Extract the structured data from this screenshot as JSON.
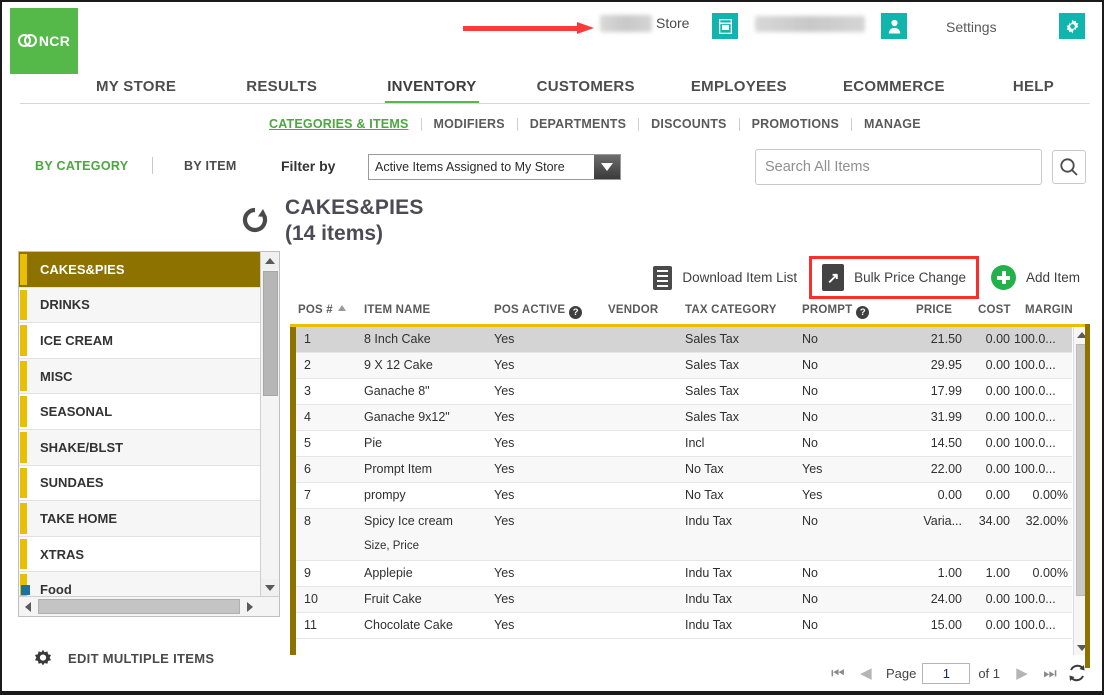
{
  "header": {
    "logo_text": "NCR",
    "store_label": "Store",
    "store_name_redacted": "",
    "user_name_redacted": "",
    "settings_label": "Settings",
    "icons": [
      "store-switch-icon",
      "user-account-icon",
      "gear-icon"
    ],
    "annotation": "red-arrow-pointing-to-store-name"
  },
  "mainnav": {
    "items": [
      {
        "label": "MY STORE",
        "active": false
      },
      {
        "label": "RESULTS",
        "active": false
      },
      {
        "label": "INVENTORY",
        "active": true
      },
      {
        "label": "CUSTOMERS",
        "active": false
      },
      {
        "label": "EMPLOYEES",
        "active": false
      },
      {
        "label": "ECOMMERCE",
        "active": false
      },
      {
        "label": "HELP",
        "active": false
      }
    ]
  },
  "subnav": {
    "items": [
      {
        "label": "CATEGORIES & ITEMS",
        "active": true
      },
      {
        "label": "MODIFIERS",
        "active": false
      },
      {
        "label": "DEPARTMENTS",
        "active": false
      },
      {
        "label": "DISCOUNTS",
        "active": false
      },
      {
        "label": "PROMOTIONS",
        "active": false
      },
      {
        "label": "MANAGE",
        "active": false
      }
    ]
  },
  "filterbar": {
    "by_category": "BY CATEGORY",
    "by_item": "BY ITEM",
    "filter_by_label": "Filter by",
    "filter_selected": "Active Items Assigned to My Store",
    "search_placeholder": "Search All Items"
  },
  "category_header": {
    "title": "CAKES&PIES",
    "count": "(14 items)"
  },
  "sidebar": {
    "categories": [
      {
        "label": "CAKES&PIES",
        "selected": true
      },
      {
        "label": "DRINKS",
        "selected": false
      },
      {
        "label": "ICE CREAM",
        "selected": false
      },
      {
        "label": "MISC",
        "selected": false
      },
      {
        "label": "SEASONAL",
        "selected": false
      },
      {
        "label": "SHAKE/BLST",
        "selected": false
      },
      {
        "label": "SUNDAES",
        "selected": false
      },
      {
        "label": "TAKE HOME",
        "selected": false
      },
      {
        "label": "XTRAS",
        "selected": false
      },
      {
        "label": "Food",
        "selected": false
      }
    ],
    "edit_multiple_label": "EDIT MULTIPLE ITEMS"
  },
  "actions": {
    "download": "Download Item List",
    "bulk_price_change": "Bulk Price Change",
    "add_item": "Add Item",
    "highlight_color": "#fb2e2e"
  },
  "table": {
    "columns": [
      "POS #",
      "ITEM NAME",
      "POS ACTIVE",
      "VENDOR",
      "TAX CATEGORY",
      "PROMPT",
      "PRICE",
      "COST",
      "MARGIN"
    ],
    "sorted_column": "POS #",
    "sort_direction": "asc",
    "rows": [
      {
        "pos": "1",
        "name": "8 Inch Cake",
        "sub": "",
        "active": "Yes",
        "vendor": "",
        "tax": "Sales Tax",
        "prompt": "No",
        "price": "21.50",
        "cost": "0.00",
        "margin": "100.0..."
      },
      {
        "pos": "2",
        "name": "9 X 12 Cake",
        "sub": "",
        "active": "Yes",
        "vendor": "",
        "tax": "Sales Tax",
        "prompt": "No",
        "price": "29.95",
        "cost": "0.00",
        "margin": "100.0..."
      },
      {
        "pos": "3",
        "name": "Ganache 8\"",
        "sub": "",
        "active": "Yes",
        "vendor": "",
        "tax": "Sales Tax",
        "prompt": "No",
        "price": "17.99",
        "cost": "0.00",
        "margin": "100.0..."
      },
      {
        "pos": "4",
        "name": "Ganache 9x12\"",
        "sub": "",
        "active": "Yes",
        "vendor": "",
        "tax": "Sales Tax",
        "prompt": "No",
        "price": "31.99",
        "cost": "0.00",
        "margin": "100.0..."
      },
      {
        "pos": "5",
        "name": "Pie",
        "sub": "",
        "active": "Yes",
        "vendor": "",
        "tax": "Incl",
        "prompt": "No",
        "price": "14.50",
        "cost": "0.00",
        "margin": "100.0..."
      },
      {
        "pos": "6",
        "name": "Prompt Item",
        "sub": "",
        "active": "Yes",
        "vendor": "",
        "tax": "No Tax",
        "prompt": "Yes",
        "price": "22.00",
        "cost": "0.00",
        "margin": "100.0..."
      },
      {
        "pos": "7",
        "name": "prompy",
        "sub": "",
        "active": "Yes",
        "vendor": "",
        "tax": "No Tax",
        "prompt": "Yes",
        "price": "0.00",
        "cost": "0.00",
        "margin": "0.00%"
      },
      {
        "pos": "8",
        "name": "Spicy Ice cream",
        "sub": "Size, Price",
        "active": "Yes",
        "vendor": "",
        "tax": "Indu Tax",
        "prompt": "No",
        "price": "Varia...",
        "cost": "34.00",
        "margin": "32.00%"
      },
      {
        "pos": "9",
        "name": "Applepie",
        "sub": "",
        "active": "Yes",
        "vendor": "",
        "tax": "Indu Tax",
        "prompt": "No",
        "price": "1.00",
        "cost": "1.00",
        "margin": "0.00%"
      },
      {
        "pos": "10",
        "name": "Fruit Cake",
        "sub": "",
        "active": "Yes",
        "vendor": "",
        "tax": "Indu Tax",
        "prompt": "No",
        "price": "24.00",
        "cost": "0.00",
        "margin": "100.0..."
      },
      {
        "pos": "11",
        "name": "Chocolate Cake",
        "sub": "",
        "active": "Yes",
        "vendor": "",
        "tax": "Indu Tax",
        "prompt": "No",
        "price": "15.00",
        "cost": "0.00",
        "margin": "100.0..."
      }
    ]
  },
  "pagination": {
    "page_label": "Page",
    "page_value": "1",
    "of_label": "of 1",
    "first_icon": "first-page-icon",
    "prev_icon": "previous-page-icon",
    "next_icon": "next-page-icon",
    "last_icon": "last-page-icon",
    "refresh_icon": "refresh-icon"
  },
  "colors": {
    "brand_green": "#54b948",
    "teal": "#12b5ad",
    "gold": "#e8c000",
    "olive": "#8e7200",
    "red_highlight": "#fb2e2e"
  }
}
